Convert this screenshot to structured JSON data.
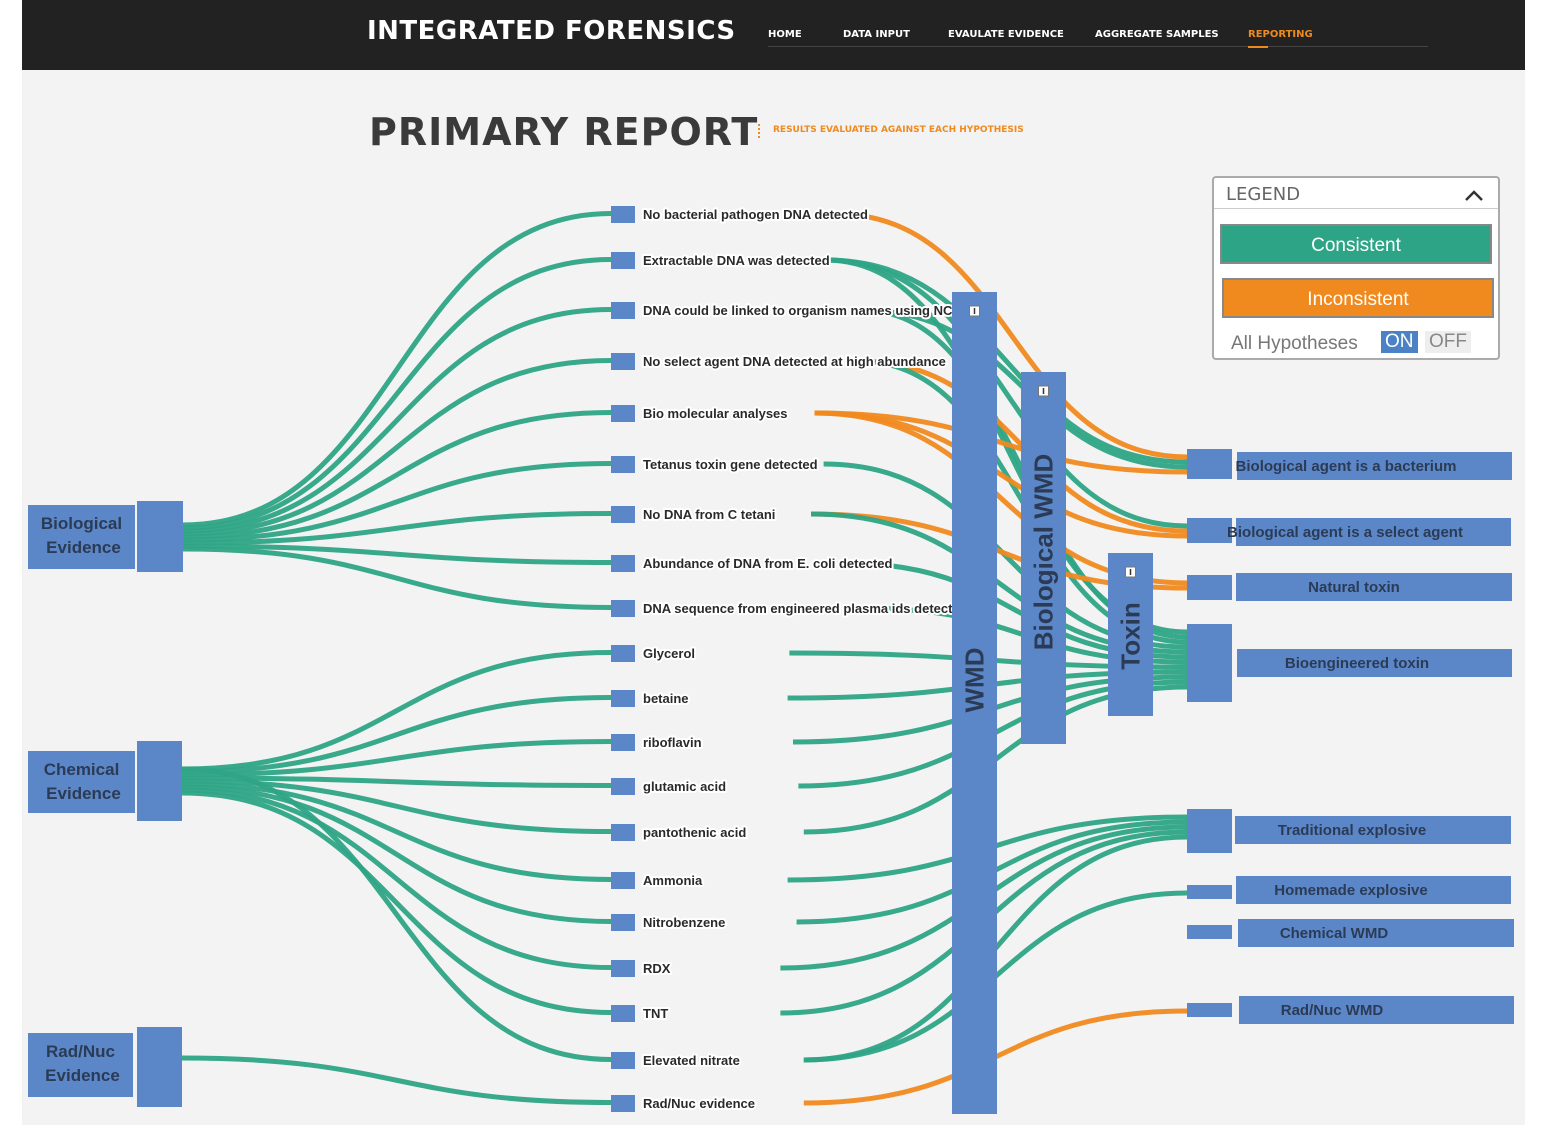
{
  "app": {
    "title": "INTEGRATED FORENSICS",
    "nav": [
      {
        "label": "HOME",
        "active": false
      },
      {
        "label": "DATA INPUT",
        "active": false
      },
      {
        "label": "EVAULATE EVIDENCE",
        "active": false
      },
      {
        "label": "AGGREGATE SAMPLES",
        "active": false
      },
      {
        "label": "REPORTING",
        "active": true
      }
    ]
  },
  "page": {
    "title": "PRIMARY REPORT",
    "subtitle": "RESULTS EVALUATED AGAINST EACH HYPOTHESIS"
  },
  "colors": {
    "consistent": "#2ea486",
    "inconsistent": "#f08a1f",
    "node": "#5b87c8",
    "accent": "#ef8a1f"
  },
  "legend": {
    "title": "LEGEND",
    "consistent_label": "Consistent",
    "inconsistent_label": "Inconsistent",
    "all_hypotheses_label": "All Hypotheses",
    "toggle_on": "ON",
    "toggle_off": "OFF",
    "icons": {
      "collapse": "chevron-up-icon"
    }
  },
  "sources": [
    {
      "id": "bio",
      "label_line1": "Biological",
      "label_line2": "Evidence"
    },
    {
      "id": "chem",
      "label_line1": "Chemical",
      "label_line2": "Evidence"
    },
    {
      "id": "rad",
      "label_line1": "Rad/Nuc",
      "label_line2": "Evidence"
    }
  ],
  "evidence": [
    {
      "label": "No bacterial pathogen DNA detected",
      "source": "bio"
    },
    {
      "label": "Extractable DNA was detected",
      "source": "bio"
    },
    {
      "label": "DNA could be linked to organism names using NCBI",
      "source": "bio"
    },
    {
      "label": "No select agent DNA detected at high abundance",
      "source": "bio"
    },
    {
      "label": "Bio molecular analyses",
      "source": "bio"
    },
    {
      "label": "Tetanus toxin gene detected",
      "source": "bio"
    },
    {
      "label": "No DNA from C tetani",
      "source": "bio"
    },
    {
      "label": "Abundance of DNA from E. coli detected",
      "source": "bio"
    },
    {
      "label": "DNA sequence from engineered plasma ids detected",
      "source": "bio"
    },
    {
      "label": "Glycerol",
      "source": "chem"
    },
    {
      "label": "betaine",
      "source": "chem"
    },
    {
      "label": "riboflavin",
      "source": "chem"
    },
    {
      "label": "glutamic acid",
      "source": "chem"
    },
    {
      "label": "pantothenic acid",
      "source": "chem"
    },
    {
      "label": "Ammonia",
      "source": "chem"
    },
    {
      "label": "Nitrobenzene",
      "source": "chem"
    },
    {
      "label": "RDX",
      "source": "chem"
    },
    {
      "label": "TNT",
      "source": "chem"
    },
    {
      "label": "Elevated nitrate",
      "source": "chem"
    },
    {
      "label": "Rad/Nuc evidence",
      "source": "rad"
    }
  ],
  "groups": [
    {
      "id": "wmd",
      "label": "WMD"
    },
    {
      "id": "biowmd",
      "label": "Biological WMD"
    },
    {
      "id": "toxin",
      "label": "Toxin"
    }
  ],
  "hypotheses": [
    {
      "label": "Biological agent is a bacterium"
    },
    {
      "label": "Biological agent is a select agent"
    },
    {
      "label": "Natural toxin"
    },
    {
      "label": "Bioengineered toxin"
    },
    {
      "label": "Traditional explosive"
    },
    {
      "label": "Homemade explosive"
    },
    {
      "label": "Chemical WMD"
    },
    {
      "label": "Rad/Nuc WMD"
    }
  ],
  "links_evidence_to_hypothesis": [
    {
      "from": "No bacterial pathogen DNA detected",
      "to": "Biological agent is a bacterium",
      "status": "inconsistent"
    },
    {
      "from": "Extractable DNA was detected",
      "to": "Biological agent is a bacterium",
      "status": "consistent"
    },
    {
      "from": "Extractable DNA was detected",
      "to": "Biological agent is a select agent",
      "status": "consistent"
    },
    {
      "from": "Extractable DNA was detected",
      "to": "Bioengineered toxin",
      "status": "consistent"
    },
    {
      "from": "DNA could be linked to organism names using NCBI",
      "to": "Biological agent is a bacterium",
      "status": "consistent"
    },
    {
      "from": "DNA could be linked to organism names using NCBI",
      "to": "Bioengineered toxin",
      "status": "consistent"
    },
    {
      "from": "No select agent DNA detected at high abundance",
      "to": "Biological agent is a select agent",
      "status": "inconsistent"
    },
    {
      "from": "No select agent DNA detected at high abundance",
      "to": "Bioengineered toxin",
      "status": "consistent"
    },
    {
      "from": "Bio molecular analyses",
      "to": "Biological agent is a bacterium",
      "status": "inconsistent"
    },
    {
      "from": "Bio molecular analyses",
      "to": "Biological agent is a select agent",
      "status": "inconsistent"
    },
    {
      "from": "Bio molecular analyses",
      "to": "Natural toxin",
      "status": "inconsistent"
    },
    {
      "from": "Tetanus toxin gene detected",
      "to": "Bioengineered toxin",
      "status": "consistent"
    },
    {
      "from": "No DNA from C tetani",
      "to": "Natural toxin",
      "status": "inconsistent"
    },
    {
      "from": "No DNA from C tetani",
      "to": "Bioengineered toxin",
      "status": "consistent"
    },
    {
      "from": "Abundance of DNA from E. coli detected",
      "to": "Bioengineered toxin",
      "status": "consistent"
    },
    {
      "from": "DNA sequence from engineered plasma ids detected",
      "to": "Bioengineered toxin",
      "status": "consistent"
    },
    {
      "from": "Glycerol",
      "to": "Bioengineered toxin",
      "status": "consistent"
    },
    {
      "from": "betaine",
      "to": "Bioengineered toxin",
      "status": "consistent"
    },
    {
      "from": "riboflavin",
      "to": "Bioengineered toxin",
      "status": "consistent"
    },
    {
      "from": "glutamic acid",
      "to": "Bioengineered toxin",
      "status": "consistent"
    },
    {
      "from": "pantothenic acid",
      "to": "Bioengineered toxin",
      "status": "consistent"
    },
    {
      "from": "Ammonia",
      "to": "Traditional explosive",
      "status": "consistent"
    },
    {
      "from": "Nitrobenzene",
      "to": "Traditional explosive",
      "status": "consistent"
    },
    {
      "from": "RDX",
      "to": "Traditional explosive",
      "status": "consistent"
    },
    {
      "from": "TNT",
      "to": "Traditional explosive",
      "status": "consistent"
    },
    {
      "from": "Elevated nitrate",
      "to": "Traditional explosive",
      "status": "consistent"
    },
    {
      "from": "Elevated nitrate",
      "to": "Homemade explosive",
      "status": "consistent"
    },
    {
      "from": "Rad/Nuc evidence",
      "to": "Rad/Nuc WMD",
      "status": "inconsistent"
    }
  ]
}
